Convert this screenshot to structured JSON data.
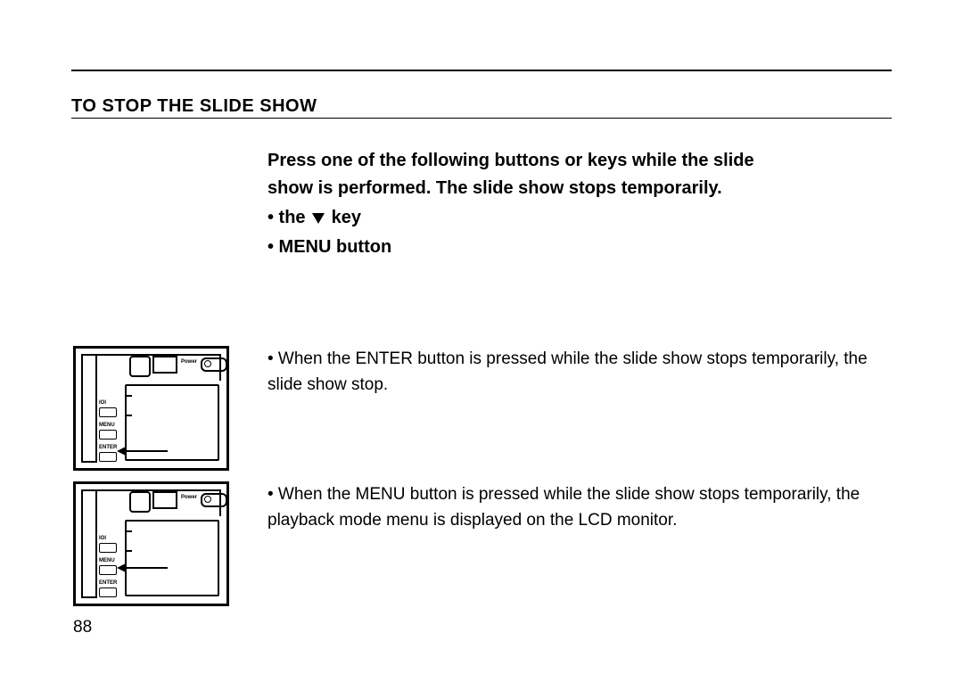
{
  "heading": "TO STOP THE SLIDE SHOW",
  "intro": {
    "line1": "Press one of the following buttons or keys while the slide",
    "line2": "show is performed. The slide show stops temporarily.",
    "bullet1_prefix": "• the ",
    "bullet1_suffix": " key",
    "bullet2": "• MENU button"
  },
  "notes": {
    "n1": "• When the ENTER button is pressed while the slide show stops temporarily, the slide show stop.",
    "n2": "• When the MENU button is pressed while the slide show stops temporarily, the playback mode menu is displayed on the LCD monitor."
  },
  "thumb_labels": {
    "power": "Power",
    "ioi": "IOI",
    "menu": "MENU",
    "enter": "ENTER"
  },
  "page_number": "88"
}
